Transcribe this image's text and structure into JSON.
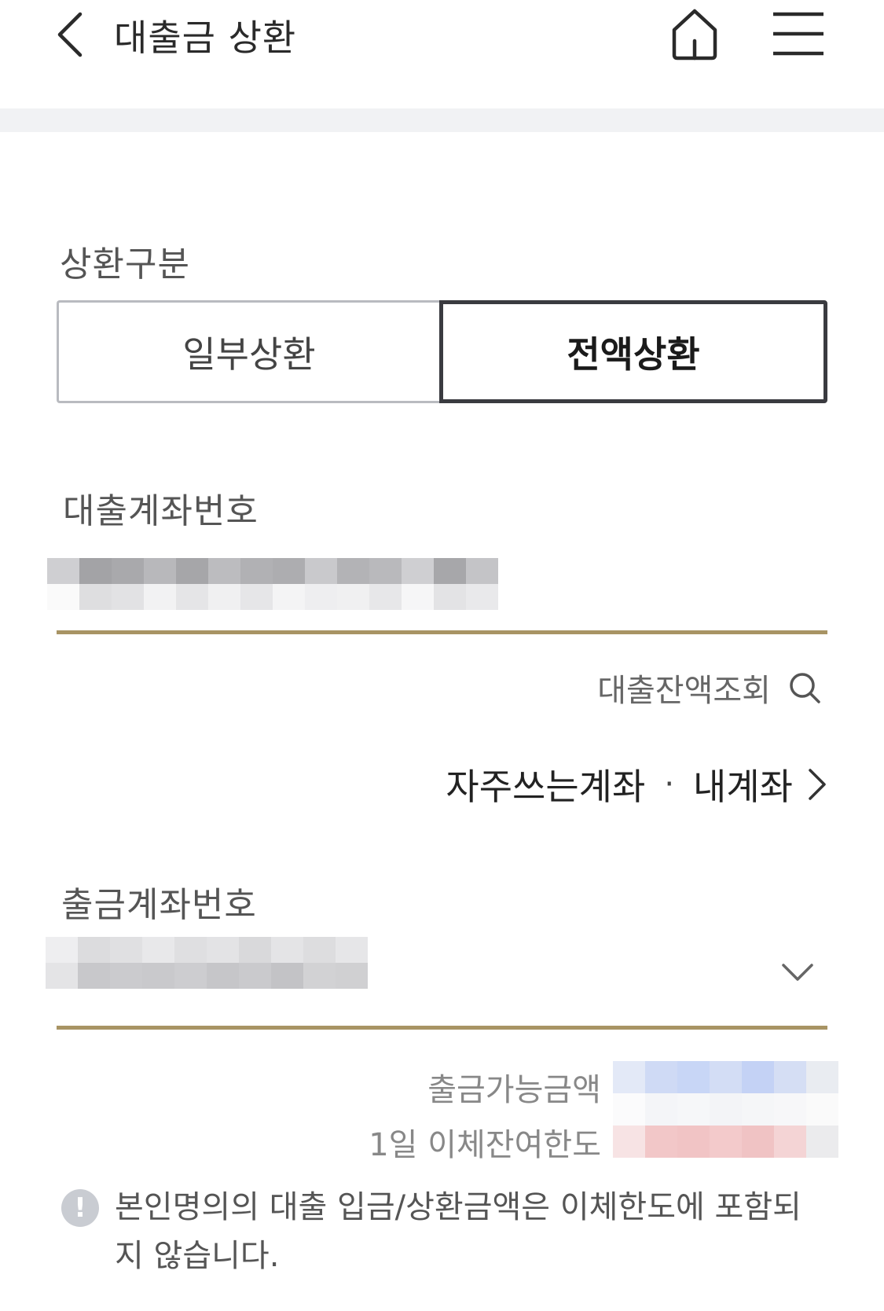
{
  "header": {
    "title": "대출금 상환",
    "back_icon": "chevron-left-icon",
    "home_icon": "home-icon",
    "menu_icon": "hamburger-menu-icon"
  },
  "repayment_type": {
    "label": "상환구분",
    "options": [
      {
        "label": "일부상환",
        "selected": false
      },
      {
        "label": "전액상환",
        "selected": true
      }
    ]
  },
  "loan_account": {
    "label": "대출계좌번호",
    "value_masked": true,
    "balance_inquiry_label": "대출잔액조회",
    "balance_inquiry_icon": "search-icon",
    "frequent_accounts_label": "자주쓰는계좌",
    "separator": "·",
    "my_accounts_label": "내계좌",
    "frequent_icon": "chevron-right-icon"
  },
  "withdrawal_account": {
    "label": "출금계좌번호",
    "value_masked": true,
    "dropdown_icon": "chevron-down-icon",
    "available_amount_label": "출금가능금액",
    "daily_transfer_limit_label": "1일 이체잔여한도"
  },
  "notice": {
    "icon": "exclamation-circle-icon",
    "text": "본인명의의 대출 입금/상환금액은 이체한도에 포함되지 않습니다."
  },
  "colors": {
    "underline": "#a89464",
    "selected_border": "#3a3b40",
    "unselected_border": "#b9bbc0",
    "divider": "#f1f2f4"
  }
}
